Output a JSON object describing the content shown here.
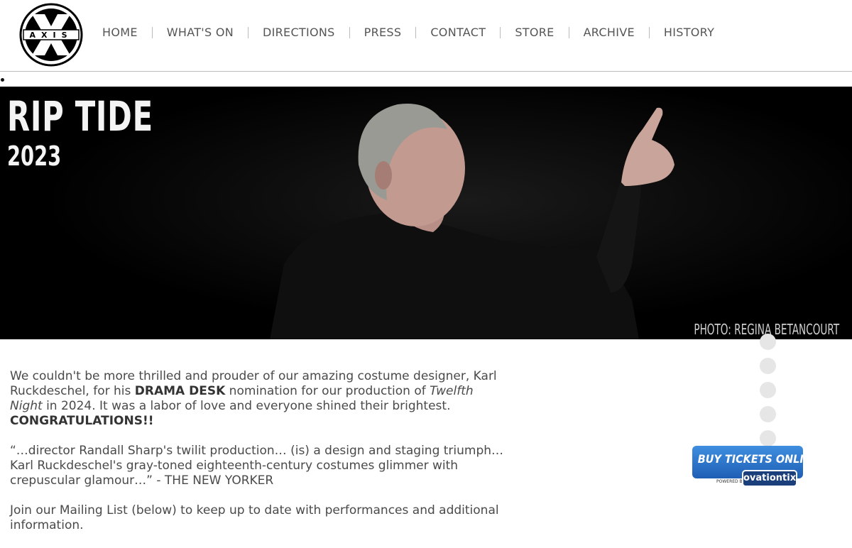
{
  "logo": {
    "text": "AXIS"
  },
  "nav": {
    "items": [
      {
        "label": "HOME"
      },
      {
        "label": "WHAT'S ON"
      },
      {
        "label": "DIRECTIONS"
      },
      {
        "label": "PRESS"
      },
      {
        "label": "CONTACT"
      },
      {
        "label": "STORE"
      },
      {
        "label": "ARCHIVE"
      },
      {
        "label": "HISTORY"
      }
    ]
  },
  "hero": {
    "title": "RIP TIDE",
    "year": "2023",
    "credit": "PHOTO: REGINA BETANCOURT"
  },
  "content": {
    "p1_a": "We couldn't be more thrilled and prouder of our amazing costume designer, Karl Ruckdeschel, for his ",
    "p1_bold": "DRAMA DESK",
    "p1_b": " nomination for our production of ",
    "p1_italic": "Twelfth Night",
    "p1_c": " in 2024. It was a labor of love and everyone shined their brightest.",
    "p1_congrats": "CONGRATULATIONS!!",
    "p2": "“…director Randall Sharp's twilit production… (is) a design and staging triumph… Karl Ruckdeschel's gray-toned eighteenth-century costumes glimmer with crepuscular glamour…” - THE NEW YORKER",
    "p3": "Join our Mailing List (below) to keep up to date with performances and additional information."
  },
  "carousel": {
    "dot_count": 5
  },
  "tickets": {
    "label": "BUY TICKETS ONLINE",
    "powered": "POWERED BY",
    "brand": "ovationtix"
  },
  "colors": {
    "nav_text": "#555555",
    "ticket_blue": "#2f7ad4",
    "hero_bg": "#000000"
  }
}
